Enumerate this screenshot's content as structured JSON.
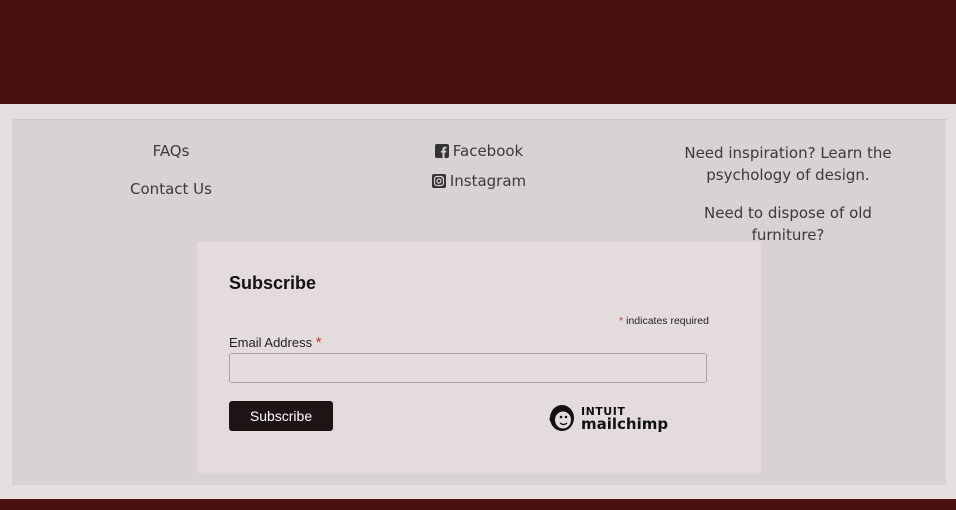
{
  "footer": {
    "left_links": [
      "FAQs",
      "Contact Us"
    ],
    "social_links": [
      {
        "label": "Facebook",
        "icon": "facebook-icon"
      },
      {
        "label": "Instagram",
        "icon": "instagram-icon"
      }
    ],
    "right_links": [
      "Need inspiration? Learn the psychology of design.",
      "Need to dispose of old furniture?"
    ]
  },
  "subscribe": {
    "title": "Subscribe",
    "required_note_star": "*",
    "required_note": " indicates required",
    "email_label": "Email Address",
    "email_required_star": "*",
    "email_value": "",
    "button_label": "Subscribe",
    "badge": {
      "line1": "INTUIT",
      "line2": "mailchimp",
      "icon": "mailchimp-freddie-icon"
    }
  },
  "colors": {
    "band": "#4a1111",
    "panel": "#d9d2d2",
    "card": "#e4dcdc",
    "button": "#1e1414",
    "required": "#c0392b"
  }
}
